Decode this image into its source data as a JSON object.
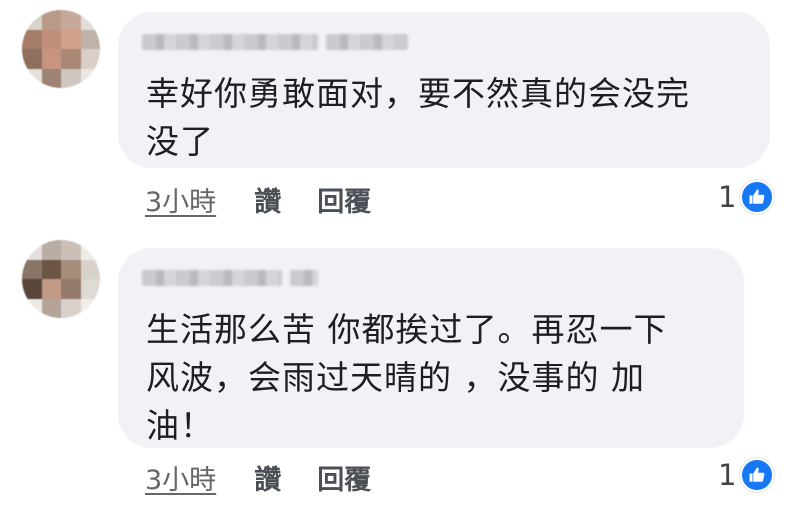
{
  "comments": [
    {
      "text_lines": [
        "幸好你勇敢面对，要不然真的会没完",
        "没了"
      ],
      "time": "3小時",
      "like_label": "讚",
      "reply_label": "回覆",
      "reaction_count": "1",
      "reaction_icon": "thumbs-up-icon"
    },
    {
      "text_lines": [
        "生活那么苦 你都挨过了。再忍一下",
        "风波，会雨过天晴的 ，没事的 加",
        "油！"
      ],
      "time": "3小時",
      "like_label": "讚",
      "reply_label": "回覆",
      "reaction_count": "1",
      "reaction_icon": "thumbs-up-icon"
    }
  ],
  "colors": {
    "bubble_bg": "#f0f2f5",
    "meta_text": "#65676b",
    "like_blue": "#1877f2"
  }
}
